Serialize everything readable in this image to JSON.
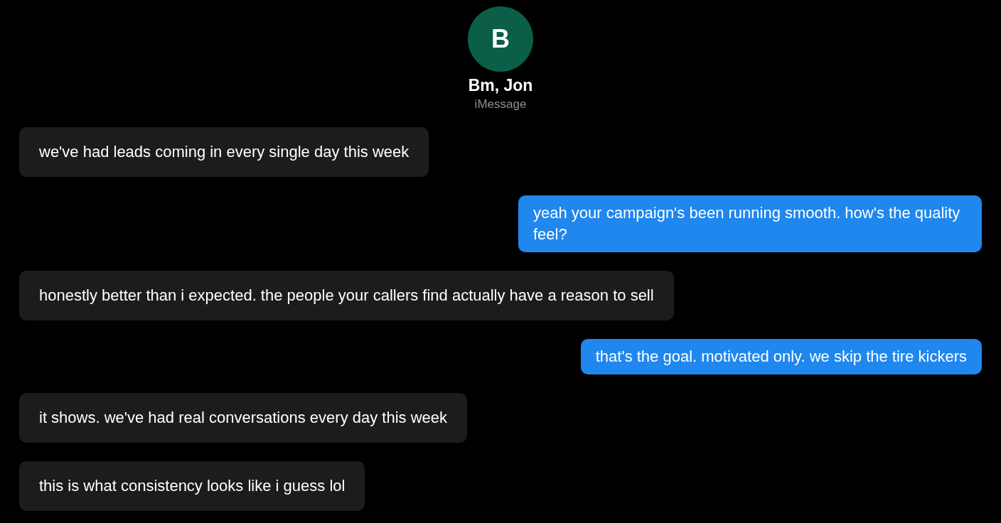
{
  "contact": {
    "initial": "B",
    "name": "Bm, Jon",
    "service": "iMessage",
    "color": "#0b5e47"
  },
  "messages": [
    {
      "kind": "incoming",
      "text": "we've had leads coming in every single day this week"
    },
    {
      "kind": "outgoing",
      "text": "yeah your campaign's been running smooth. how's the quality feel?"
    },
    {
      "kind": "incoming",
      "text": "honestly better than i expected. the people your callers find actually have a reason to sell"
    },
    {
      "kind": "outgoing",
      "text": "that's the goal. motivated only. we skip the tire kickers"
    },
    {
      "kind": "incoming",
      "text": "it shows. we've had real conversations every day this week"
    },
    {
      "kind": "incoming",
      "text": "this is what consistency looks like i guess lol"
    }
  ]
}
